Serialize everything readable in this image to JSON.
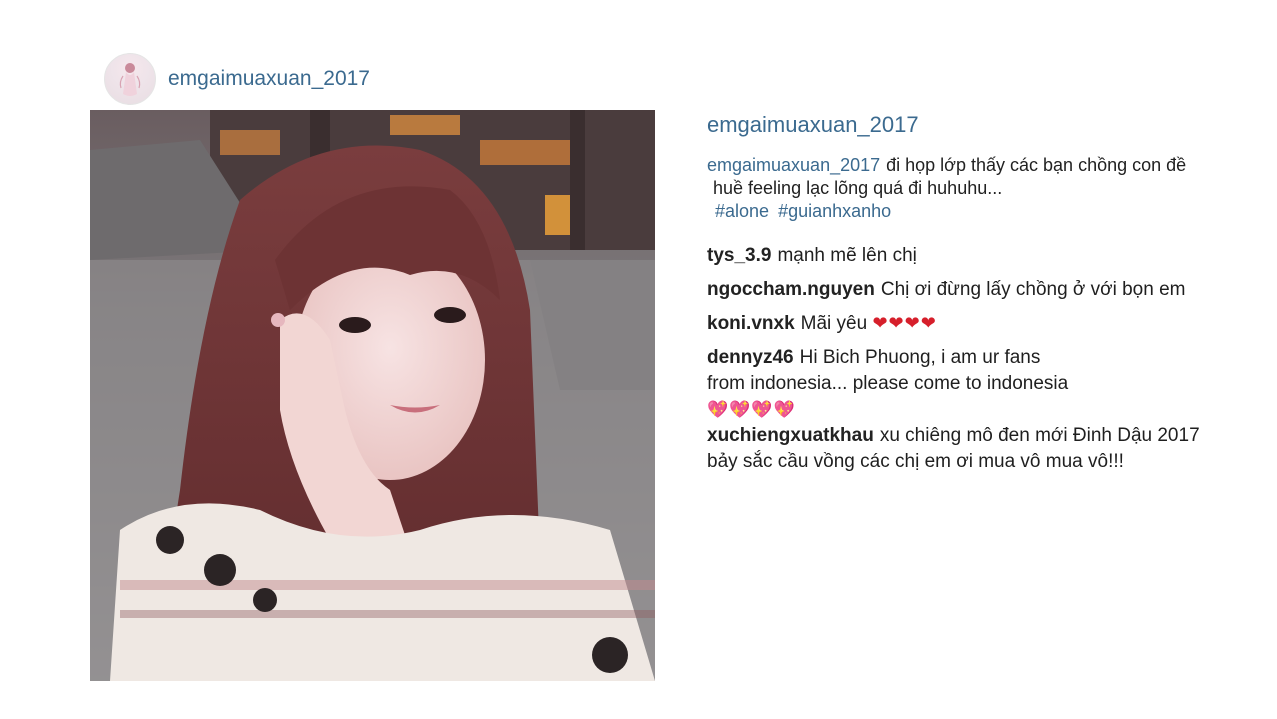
{
  "header": {
    "username": "emgaimuaxuan_2017"
  },
  "photo": {
    "description_icon": "selfie-photo"
  },
  "panel": {
    "username": "emgaimuaxuan_2017",
    "caption_user": "emgaimuaxuan_2017",
    "caption_line1": "đi họp lớp thấy các bạn chồng con đề",
    "caption_line2": "huề feeling lạc lõng quá đi huhuhu...",
    "hashtags": [
      "#alone",
      "#guianhxanho"
    ]
  },
  "comments": [
    {
      "user": "tys_3.9",
      "text": "mạnh mẽ lên chị"
    },
    {
      "user": "ngoccham.nguyen",
      "text": "Chị ơi đừng lấy chồng ở với bọn em"
    },
    {
      "user": "koni.vnxk",
      "text": "Mãi yêu",
      "emoji": "❤❤❤❤"
    },
    {
      "user": "dennyz46",
      "text": "Hi Bich Phuong, i am ur fans",
      "text2": "from indonesia... please come to indonesia",
      "emoji": "💖💖💖💖"
    },
    {
      "user": "xuchiengxuatkhau",
      "text": "xu chiêng mô đen mới Đinh Dậu 2017",
      "text2": "bảy sắc cầu vồng các chị em ơi mua vô mua vô!!!"
    }
  ],
  "colors": {
    "link_blue": "#3b6a8f",
    "text_dark": "#222222",
    "heart_red": "#d61f2b",
    "heart_pink": "#e43fb0"
  }
}
